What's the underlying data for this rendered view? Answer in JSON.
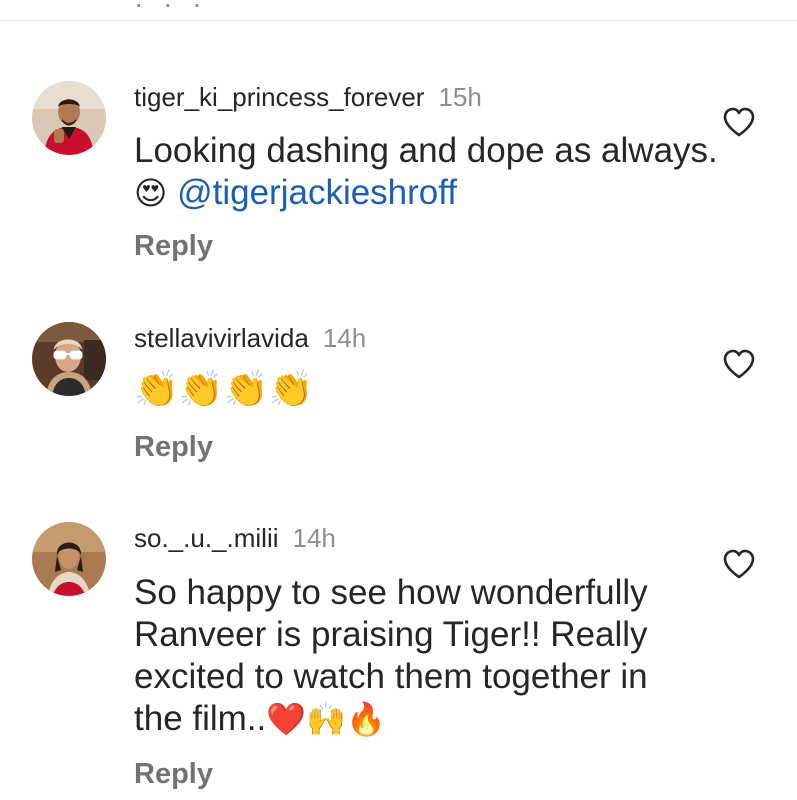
{
  "comments": [
    {
      "username": "tiger_ki_princess_forever",
      "time": "15h",
      "text_part1": "Looking dashing and dope as always. ",
      "emoji1": "😍",
      "mention": " @tigerjackieshroff",
      "reply_label": "Reply",
      "avatar": "man-red-jacket-avatar"
    },
    {
      "username": "stellavivirlavida",
      "time": "14h",
      "emoji": "👏👏👏👏",
      "reply_label": "Reply",
      "avatar": "woman-white-glasses-avatar"
    },
    {
      "username": "so._.u._.milii",
      "time": "14h",
      "text_line1": "So happy to see how wonderfully",
      "text_line2": "Ranveer is praising Tiger!! Really",
      "text_line3": "excited to watch them together in",
      "text_line4": "the film..",
      "emoji_end": "❤️🙌🔥",
      "reply_label": "Reply",
      "avatar": "girl-red-outfit-avatar"
    }
  ],
  "colors": {
    "text": "#262626",
    "secondary": "#8e8e8e",
    "mention": "#1a5fb4",
    "reply": "#737373"
  },
  "icons": {
    "like": "heart-outline-icon"
  }
}
